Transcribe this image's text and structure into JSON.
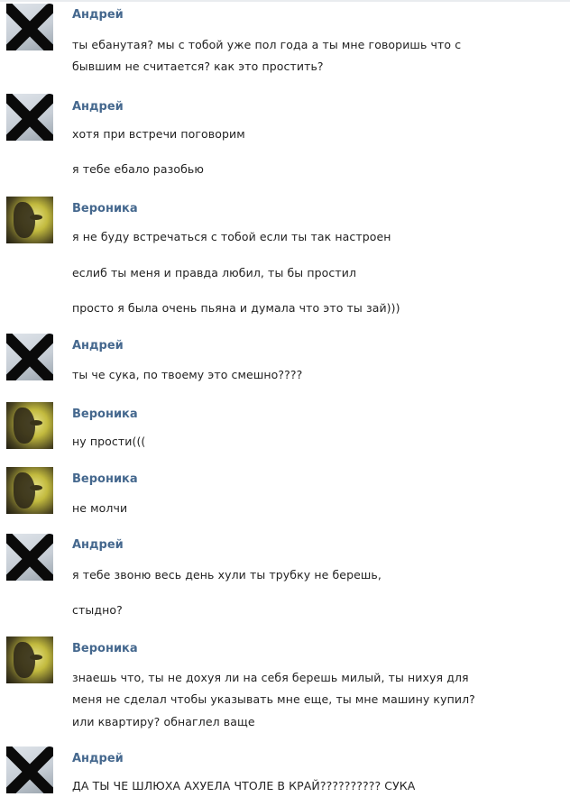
{
  "colors": {
    "author_name": "#45688e",
    "text": "#222222",
    "background": "#ffffff"
  },
  "messages": [
    {
      "author": "Андрей",
      "avatar": "crossed-out-avatar",
      "lines": [
        "ты ебанутая? мы с тобой уже пол года а ты мне говоришь что с",
        "бывшим не считается? как это простить?"
      ]
    },
    {
      "author": "Андрей",
      "avatar": "crossed-out-avatar",
      "lines": [
        "хотя при встречи поговорим",
        "я тебе ебало разобью"
      ]
    },
    {
      "author": "Вероника",
      "avatar": "girl-portrait-avatar",
      "lines": [
        "я не буду встречаться с тобой если ты так настроен",
        "еслиб ты меня и правда любил, ты бы простил",
        "просто я была очень пьяна и думала что это ты зай)))"
      ]
    },
    {
      "author": "Андрей",
      "avatar": "crossed-out-avatar",
      "lines": [
        "ты че сука, по твоему это смешно????"
      ]
    },
    {
      "author": "Вероника",
      "avatar": "girl-portrait-avatar",
      "lines": [
        "ну прости((("
      ]
    },
    {
      "author": "Вероника",
      "avatar": "girl-portrait-avatar",
      "lines": [
        "не молчи"
      ]
    },
    {
      "author": "Андрей",
      "avatar": "crossed-out-avatar",
      "lines": [
        "я тебе звоню весь день хули ты трубку не берешь,",
        "стыдно?"
      ]
    },
    {
      "author": "Вероника",
      "avatar": "girl-portrait-avatar",
      "lines": [
        "знаешь что, ты не дохуя ли на себя берешь милый, ты нихуя для",
        "меня не сделал чтобы указывать мне еще, ты мне машину купил?",
        "или квартиру? обнаглел ваще"
      ]
    },
    {
      "author": "Андрей",
      "avatar": "crossed-out-avatar",
      "lines": [
        "ДА ТЫ ЧЕ ШЛЮХА АХУЕЛА ЧТОЛЕ В КРАЙ?????????? СУКА"
      ]
    }
  ]
}
